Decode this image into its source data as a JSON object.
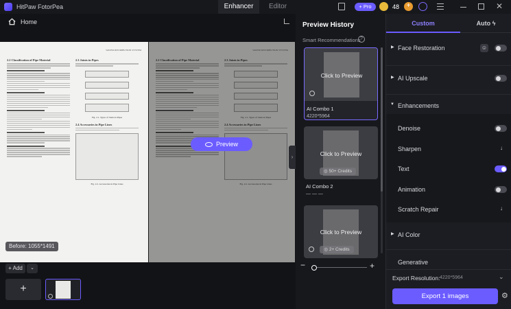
{
  "app": {
    "title": "HitPaw FotorPea"
  },
  "tabs": [
    {
      "label": "Enhancer"
    },
    {
      "label": "Editor"
    }
  ],
  "account": {
    "pro_label": "Pro",
    "credits": "48"
  },
  "toolbar": {
    "home_label": "Home"
  },
  "canvas": {
    "before_label": "Before: 1055*1491",
    "preview_label": "Preview",
    "add_label": "Add"
  },
  "history": {
    "title": "Preview History",
    "smart_label": "Smart Recommendations",
    "cards": [
      {
        "cta": "Click to Preview",
        "name": "AI Combo 1",
        "resolution": "4220*5964",
        "badge": ""
      },
      {
        "cta": "Click to Preview",
        "name": "AI Combo 2",
        "resolution": "— — —",
        "badge": "50+ Credits"
      },
      {
        "cta": "Click to Preview",
        "name": "",
        "resolution": "",
        "badge": "2+ Credits"
      }
    ]
  },
  "panel": {
    "tabs": [
      {
        "label": "Custom"
      },
      {
        "label": "Auto"
      }
    ],
    "sections": {
      "face_restoration": "Face Restoration",
      "ai_upscale": "AI Upscale",
      "enhancements": "Enhancements",
      "ai_color": "AI Color",
      "generative": "Generative"
    },
    "items": {
      "denoise": "Denoise",
      "sharpen": "Sharpen",
      "text": "Text",
      "animation": "Animation",
      "scratch_repair": "Scratch Repair"
    },
    "export_resolution_label": "Export Resolution:",
    "export_resolution_value": "4220*5964",
    "export_button": "Export 1 images"
  },
  "document": {
    "running_header": "WATER DISTRIBUTION SYSTEM",
    "sections": [
      "2.2 Classification of Pipe Material",
      "2.3 Joints in Pipes",
      "2.4 Accessories in Pipe Lines"
    ],
    "captions": [
      "Fig. 2.1. Types of Joints in Pipes",
      "Fig. 2.2. Accessories in Pipe Lines"
    ]
  },
  "colors": {
    "accent": "#6b5cff",
    "background": "#101114",
    "panel": "#1c1d22"
  }
}
